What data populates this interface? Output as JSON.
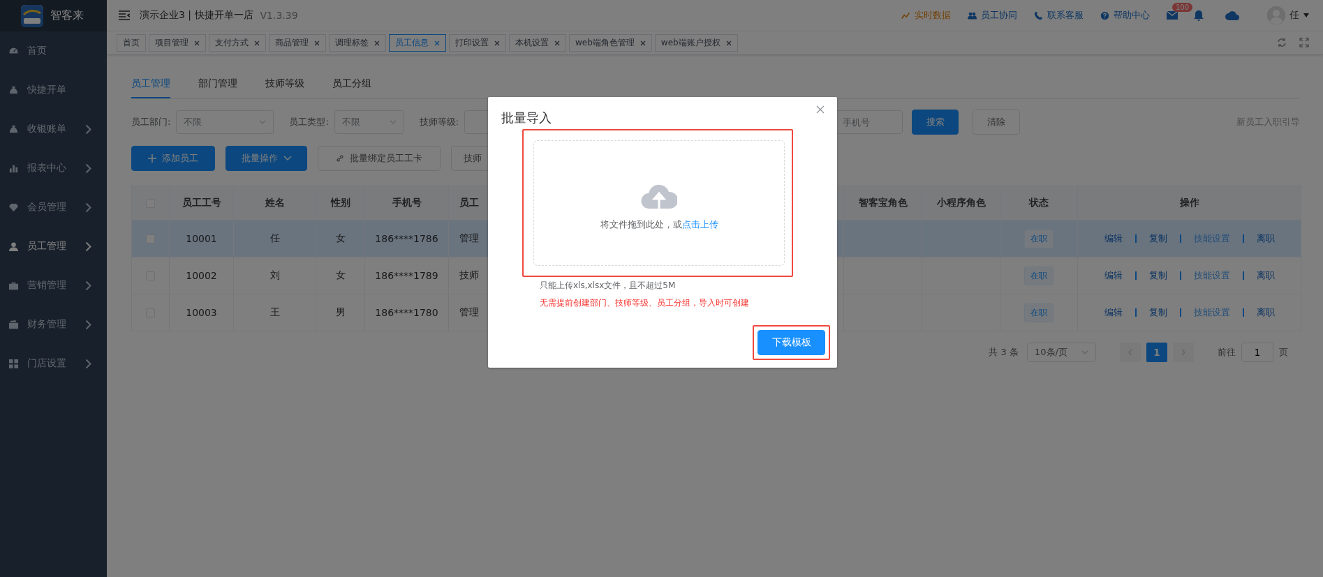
{
  "sidebar": {
    "brand": "智客来",
    "items": [
      {
        "label": "首页",
        "expandable": false,
        "selected": false
      },
      {
        "label": "快捷开单",
        "expandable": false,
        "selected": false
      },
      {
        "label": "收银账单",
        "expandable": true,
        "selected": false
      },
      {
        "label": "报表中心",
        "expandable": true,
        "selected": false
      },
      {
        "label": "会员管理",
        "expandable": true,
        "selected": false
      },
      {
        "label": "员工管理",
        "expandable": true,
        "selected": true
      },
      {
        "label": "营销管理",
        "expandable": true,
        "selected": false
      },
      {
        "label": "财务管理",
        "expandable": true,
        "selected": false
      },
      {
        "label": "门店设置",
        "expandable": true,
        "selected": false
      }
    ]
  },
  "header": {
    "title": "演示企业3 | 快捷开单一店",
    "version": "V1.3.39",
    "links": [
      {
        "label": "实时数据",
        "emphasized": true
      },
      {
        "label": "员工协同",
        "emphasized": false
      },
      {
        "label": "联系客服",
        "emphasized": false
      },
      {
        "label": "帮助中心",
        "emphasized": false
      }
    ],
    "mail_badge": "100",
    "user": "任"
  },
  "tabs": [
    {
      "label": "首页",
      "closable": false,
      "selected": false
    },
    {
      "label": "项目管理",
      "closable": true,
      "selected": false
    },
    {
      "label": "支付方式",
      "closable": true,
      "selected": false
    },
    {
      "label": "商品管理",
      "closable": true,
      "selected": false
    },
    {
      "label": "调理标签",
      "closable": true,
      "selected": false
    },
    {
      "label": "员工信息",
      "closable": true,
      "selected": true
    },
    {
      "label": "打印设置",
      "closable": true,
      "selected": false
    },
    {
      "label": "本机设置",
      "closable": true,
      "selected": false
    },
    {
      "label": "web端角色管理",
      "closable": true,
      "selected": false
    },
    {
      "label": "web端账户授权",
      "closable": true,
      "selected": false
    }
  ],
  "subtabs": [
    {
      "label": "员工管理",
      "selected": true
    },
    {
      "label": "部门管理",
      "selected": false
    },
    {
      "label": "技师等级",
      "selected": false
    },
    {
      "label": "员工分组",
      "selected": false
    }
  ],
  "filters": [
    {
      "label": "员工部门:",
      "placeholder": "不限"
    },
    {
      "label": "员工类型:",
      "placeholder": "不限"
    },
    {
      "label": "技师等级:"
    }
  ],
  "phone_field": {
    "placeholder": "手机号"
  },
  "search_button": "搜索",
  "clear_button": "清除",
  "guide_link": "新员工入职引导",
  "toolbar": [
    {
      "label": "添加员工",
      "kind": "add"
    },
    {
      "label": "批量操作",
      "kind": "dropdown"
    },
    {
      "label": "批量绑定员工工卡",
      "kind": "link"
    },
    {
      "label": "技师",
      "kind": "plain"
    }
  ],
  "table": {
    "select_all_checked": false,
    "columns": [
      "员工工号",
      "姓名",
      "性别",
      "手机号",
      "员工",
      "智客宝角色",
      "小程序角色",
      "状态",
      "操作"
    ],
    "rows": [
      {
        "selected": true,
        "checked": false,
        "cells": [
          "10001",
          "任",
          "女",
          "186****1786",
          "管理"
        ],
        "status": "在职",
        "actions": [
          {
            "label": "编辑",
            "disabled": false
          },
          {
            "label": "复制",
            "disabled": false
          },
          {
            "label": "技能设置",
            "disabled": true
          },
          {
            "label": "离职",
            "disabled": false
          }
        ]
      },
      {
        "selected": false,
        "checked": false,
        "cells": [
          "10002",
          "刘",
          "女",
          "186****1789",
          "技师"
        ],
        "status": "在职",
        "actions": [
          {
            "label": "编辑",
            "disabled": false
          },
          {
            "label": "复制",
            "disabled": false
          },
          {
            "label": "技能设置",
            "disabled": true
          },
          {
            "label": "离职",
            "disabled": false
          }
        ]
      },
      {
        "selected": false,
        "checked": false,
        "cells": [
          "10003",
          "王",
          "男",
          "186****1780",
          "管理"
        ],
        "status": "在职",
        "actions": [
          {
            "label": "编辑",
            "disabled": false
          },
          {
            "label": "复制",
            "disabled": false
          },
          {
            "label": "技能设置",
            "disabled": true
          },
          {
            "label": "离职",
            "disabled": false
          }
        ]
      }
    ]
  },
  "pagination": {
    "total": "共 3 条",
    "page_size": "10条/页",
    "pages": [
      {
        "label": "1",
        "selected": true
      }
    ],
    "goto_label": "前往",
    "goto_value": "1",
    "goto_suffix": "页"
  },
  "dialog": {
    "title": "批量导入",
    "upload": {
      "text": "将文件拖到此处，或",
      "link": "点击上传",
      "highlighted": true
    },
    "tip": "只能上传xls,xlsx文件，且不超过5M",
    "warning": "无需提前创建部门、技师等级、员工分组，导入时可创建",
    "button": {
      "label": "下载模板",
      "highlighted": true
    }
  }
}
